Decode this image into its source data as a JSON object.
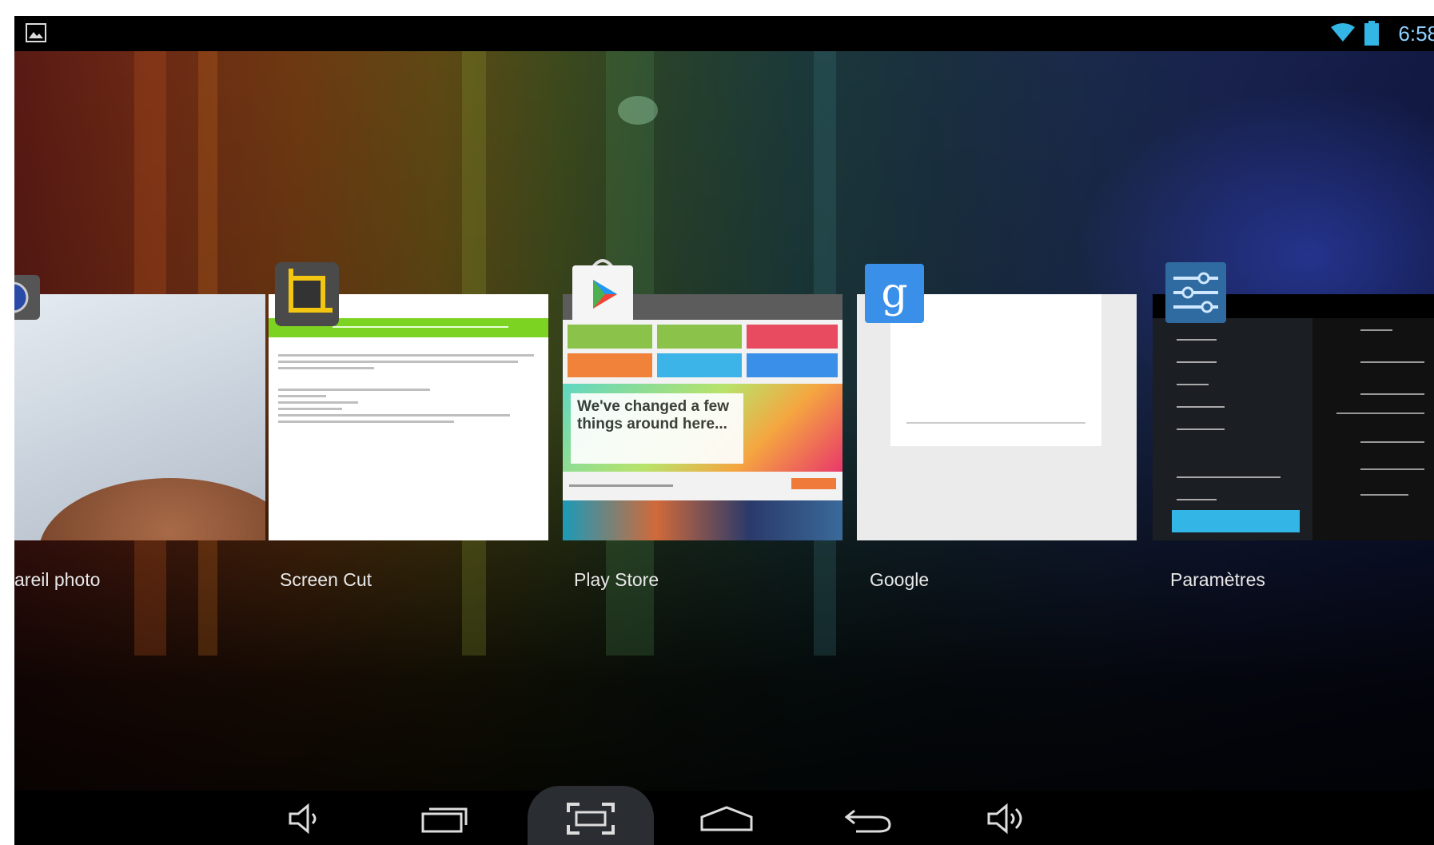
{
  "status_bar": {
    "time": "6:58",
    "icons": [
      "gallery-icon",
      "wifi-icon",
      "battery-icon"
    ],
    "time_color": "#8fd0ff"
  },
  "recent_apps": [
    {
      "label": "areil photo",
      "icon": "camera-icon"
    },
    {
      "label": "Screen Cut",
      "icon": "crop-icon"
    },
    {
      "label": "Play Store",
      "icon": "play-store-icon"
    },
    {
      "label": "Google",
      "icon": "google-icon"
    },
    {
      "label": "Paramètres",
      "icon": "settings-icon"
    }
  ],
  "play_store_thumb": {
    "headline": "We've changed a few things around here..."
  },
  "nav_bar": {
    "buttons": [
      "volume-down-icon",
      "recent-apps-icon",
      "screenshot-icon",
      "home-icon",
      "back-icon",
      "volume-up-icon"
    ],
    "active": "screenshot-icon"
  },
  "colors": {
    "accent_blue": "#33b5e5",
    "screen_cut_green": "#7cd321",
    "play_green": "#8bc34a",
    "play_red": "#e84a5f",
    "play_orange": "#f0823a",
    "play_blue": "#3a8fe8"
  }
}
